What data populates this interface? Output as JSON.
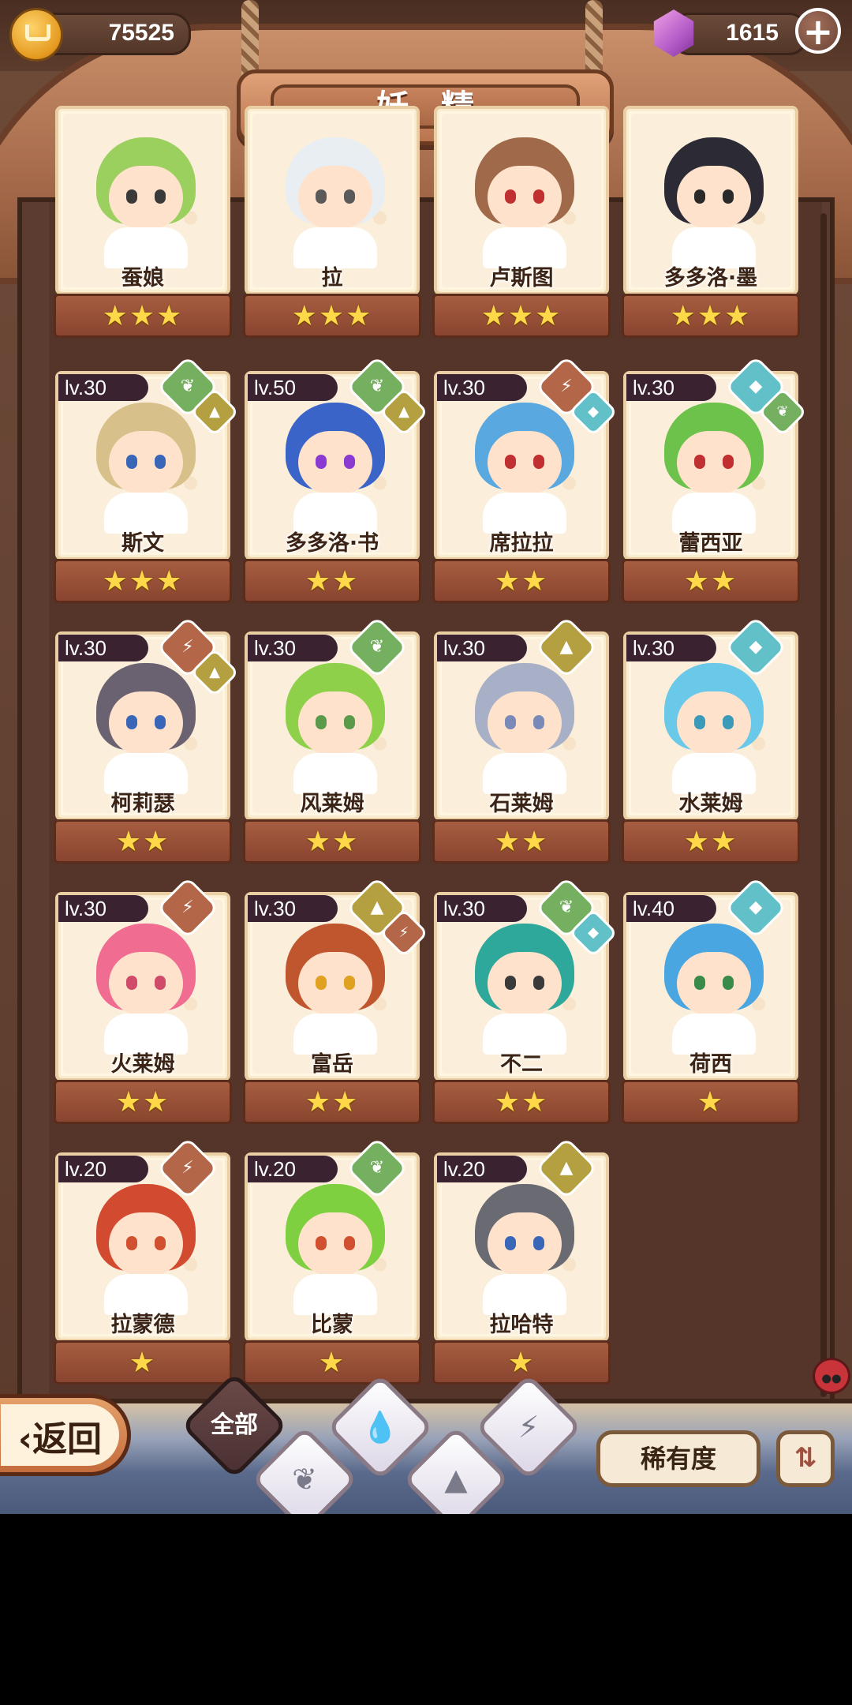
{
  "header": {
    "title": "妖精",
    "coins": "75525",
    "gems": "1615",
    "coin_icon": "crown-coin-icon",
    "gem_icon": "pink-gem-icon"
  },
  "element_icons": {
    "grass": {
      "icon": "leaf-icon",
      "color": "#74b060"
    },
    "rock": {
      "icon": "mountain-icon",
      "color": "#b4a040"
    },
    "fire": {
      "icon": "lightning-rock-icon",
      "color": "#b46648"
    },
    "water": {
      "icon": "water-drop-icon",
      "color": "#62c0c8"
    }
  },
  "fairies": [
    {
      "name": "蚕娘",
      "level": "",
      "stars": "★★★",
      "elements": []
    },
    {
      "name": "拉",
      "level": "",
      "stars": "★★★",
      "elements": []
    },
    {
      "name": "卢斯图",
      "level": "",
      "stars": "★★★",
      "elements": []
    },
    {
      "name": "多多洛·墨",
      "level": "",
      "stars": "★★★",
      "elements": []
    },
    {
      "name": "斯文",
      "level": "lv.30",
      "stars": "★★★",
      "elements": [
        "grass",
        "rock"
      ]
    },
    {
      "name": "多多洛·书",
      "level": "lv.50",
      "stars": "★★",
      "elements": [
        "grass",
        "rock"
      ]
    },
    {
      "name": "席拉拉",
      "level": "lv.30",
      "stars": "★★",
      "elements": [
        "fire",
        "water"
      ]
    },
    {
      "name": "蕾西亚",
      "level": "lv.30",
      "stars": "★★",
      "elements": [
        "water",
        "grass"
      ]
    },
    {
      "name": "柯莉瑟",
      "level": "lv.30",
      "stars": "★★",
      "elements": [
        "fire",
        "rock"
      ]
    },
    {
      "name": "风莱姆",
      "level": "lv.30",
      "stars": "★★",
      "elements": [
        "grass"
      ]
    },
    {
      "name": "石莱姆",
      "level": "lv.30",
      "stars": "★★",
      "elements": [
        "rock"
      ]
    },
    {
      "name": "水莱姆",
      "level": "lv.30",
      "stars": "★★",
      "elements": [
        "water"
      ]
    },
    {
      "name": "火莱姆",
      "level": "lv.30",
      "stars": "★★",
      "elements": [
        "fire"
      ]
    },
    {
      "name": "富岳",
      "level": "lv.30",
      "stars": "★★",
      "elements": [
        "rock",
        "fire"
      ]
    },
    {
      "name": "不二",
      "level": "lv.30",
      "stars": "★★",
      "elements": [
        "grass",
        "water"
      ]
    },
    {
      "name": "荷西",
      "level": "lv.40",
      "stars": "★",
      "elements": [
        "water"
      ]
    },
    {
      "name": "拉蒙德",
      "level": "lv.20",
      "stars": "★",
      "elements": [
        "fire"
      ]
    },
    {
      "name": "比蒙",
      "level": "lv.20",
      "stars": "★",
      "elements": [
        "grass"
      ]
    },
    {
      "name": "拉哈特",
      "level": "lv.20",
      "stars": "★",
      "elements": [
        "rock"
      ]
    }
  ],
  "footer": {
    "back_label": "返回",
    "filter_all_label": "全部",
    "rarity_label": "稀有度",
    "sort_icon": "sort-list-icon"
  }
}
